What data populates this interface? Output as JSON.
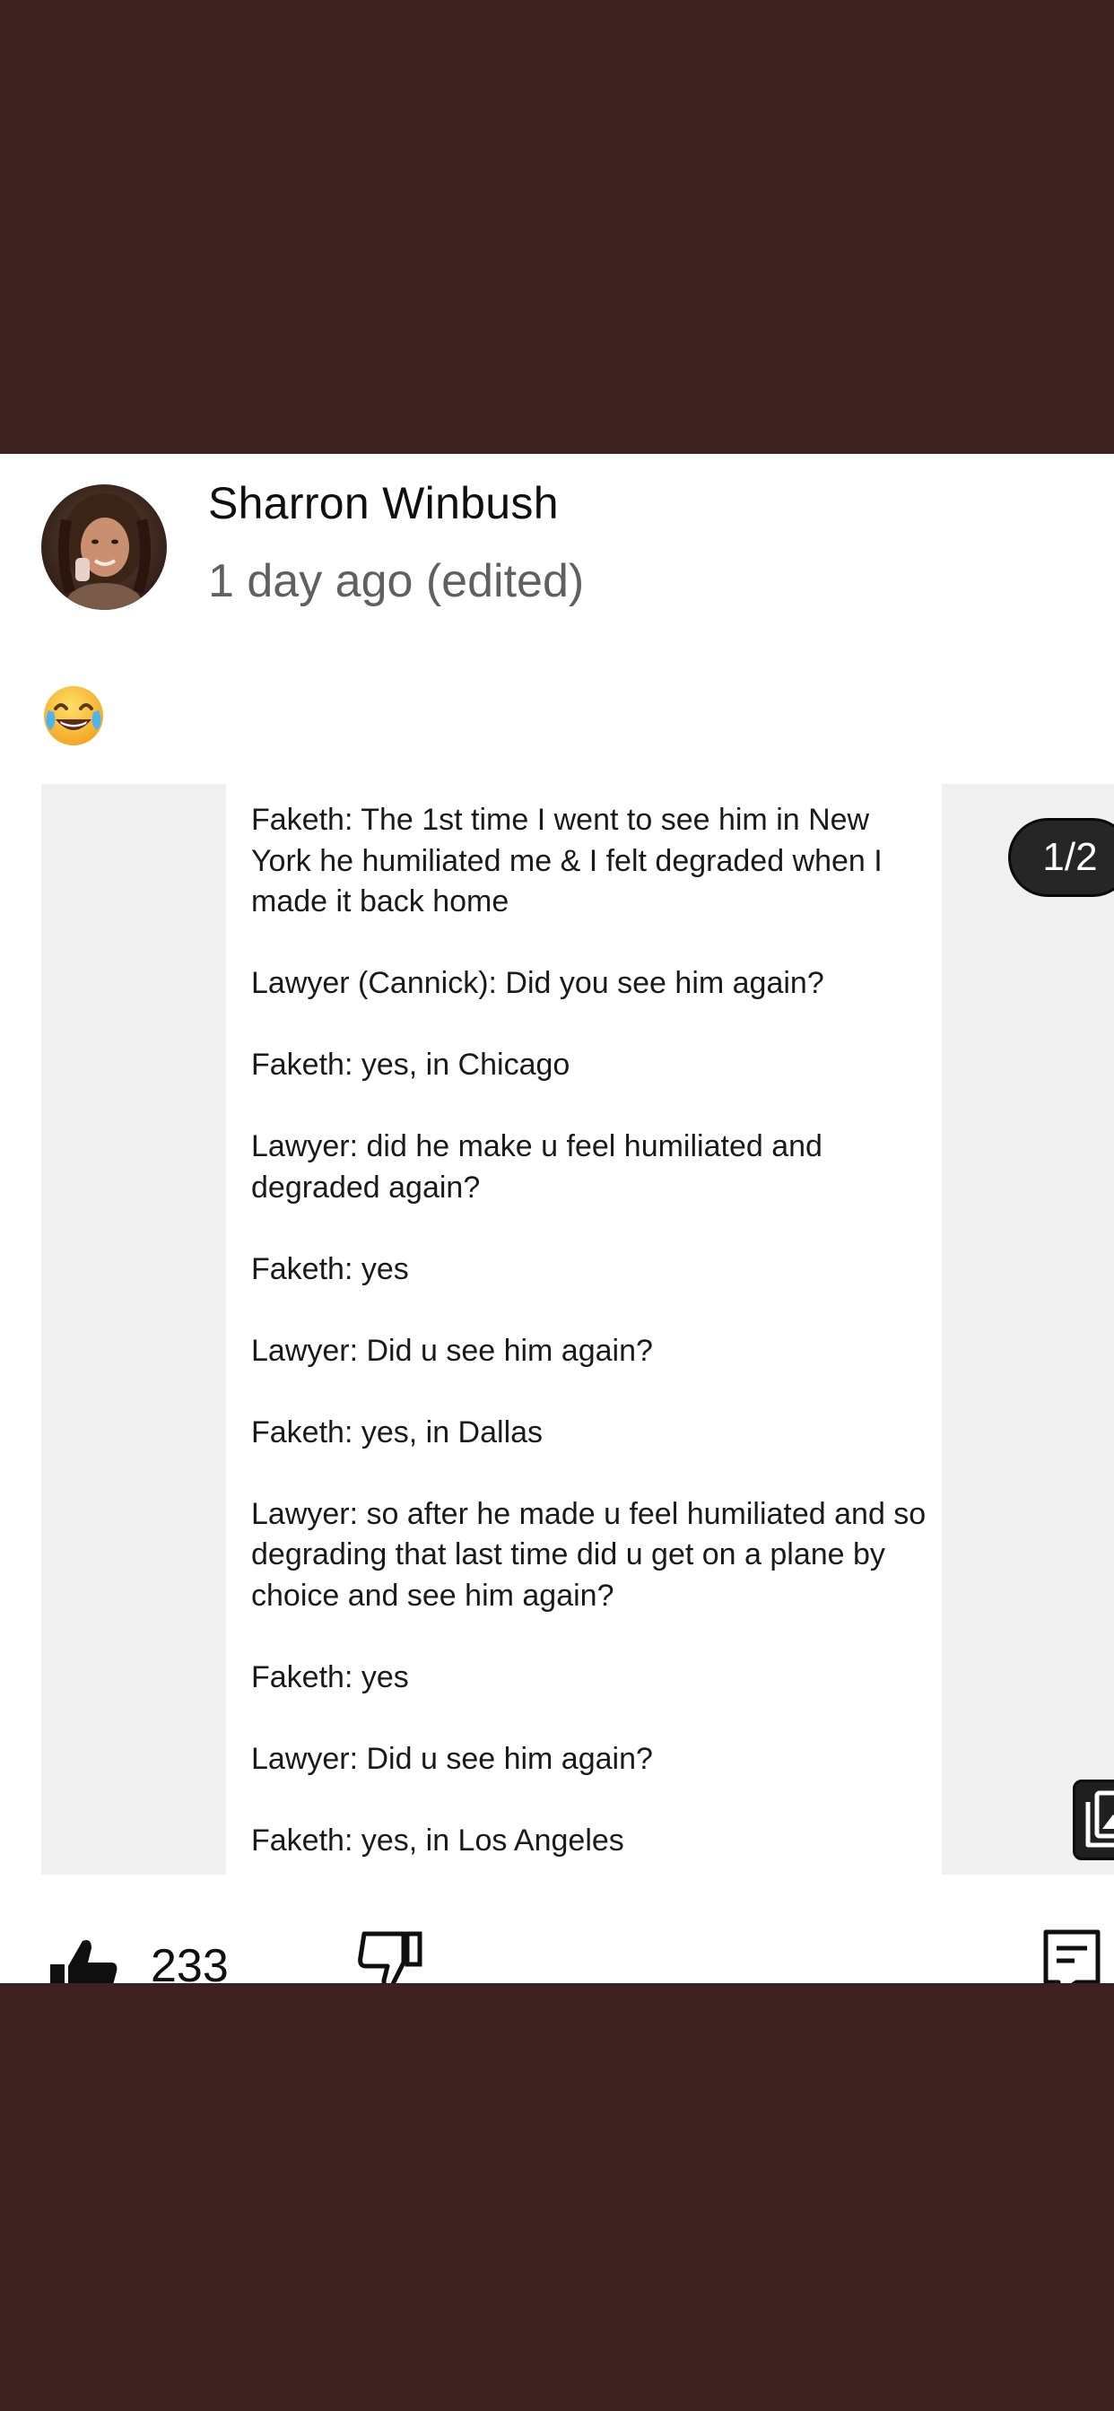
{
  "comment": {
    "author": "Sharron Winbush",
    "timestamp": "1 day ago (edited)",
    "emoji": "face-with-tears-of-joy",
    "like_count": "233"
  },
  "media": {
    "page_counter": "1/2",
    "transcript": [
      "Faketh: The 1st time I went to see him in New York he humiliated me & I felt degraded when I made it back home",
      "Lawyer (Cannick):  Did you see him again?",
      "Faketh: yes, in Chicago",
      "Lawyer: did he make u feel humiliated and degraded again?",
      "Faketh: yes",
      "Lawyer: Did u see him again?",
      "Faketh: yes, in Dallas",
      "Lawyer: so after he made u feel humiliated and so degrading that last time did u get on a plane by choice and see him again?",
      "Faketh: yes",
      "Lawyer: Did u see him again?",
      "Faketh: yes, in Los Angeles"
    ]
  },
  "icons": {
    "like": "thumbs-up-icon",
    "dislike": "thumbs-down-icon",
    "gallery": "image-gallery-icon",
    "reply": "reply-icon"
  },
  "colors": {
    "backdrop": "#3d2020",
    "card": "#ffffff",
    "media_background": "#f0f0f0",
    "badge": "#262626",
    "primary_text": "#0f0f0f",
    "secondary_text": "#606060"
  }
}
